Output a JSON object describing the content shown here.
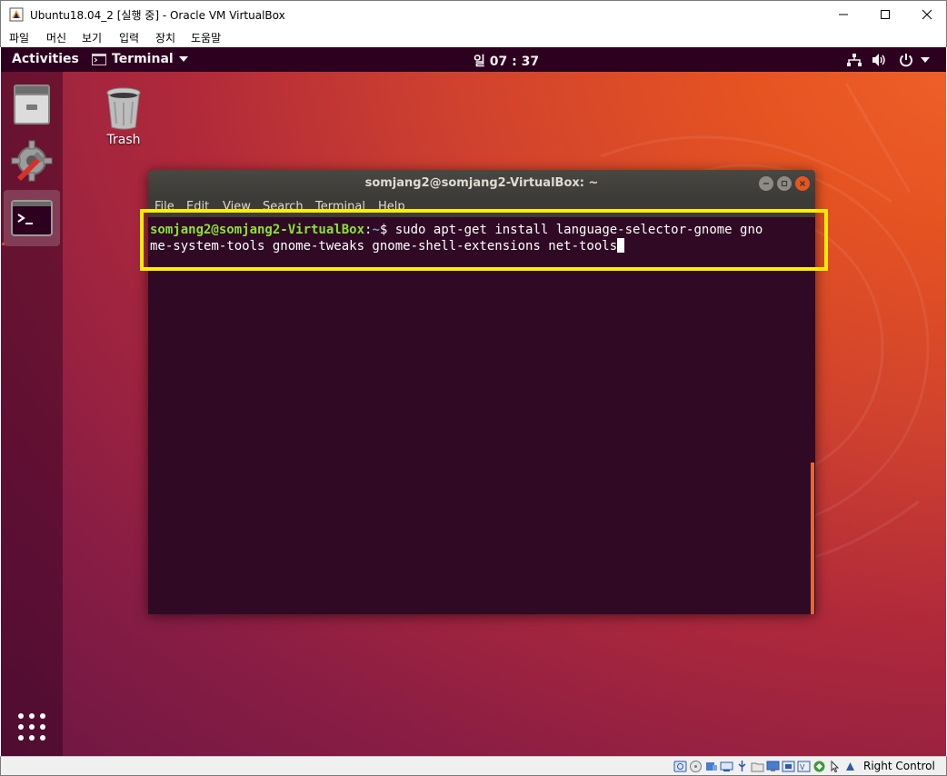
{
  "host_window": {
    "title": "Ubuntu18.04_2 [실행 중] - Oracle VM VirtualBox",
    "menu": [
      "파일",
      "머신",
      "보기",
      "입력",
      "장치",
      "도움말"
    ],
    "controls": {
      "minimize_icon": "minimize-icon",
      "maximize_icon": "maximize-icon",
      "close_icon": "close-icon"
    },
    "status": {
      "host_key": "Right Control"
    }
  },
  "gnome": {
    "activities_label": "Activities",
    "app_menu_label": "Terminal",
    "clock": "일 07 : 37",
    "tray_icons": [
      "network-icon",
      "volume-icon",
      "power-icon"
    ]
  },
  "dock": {
    "items": [
      {
        "name": "files",
        "icon": "file-cabinet-icon"
      },
      {
        "name": "settings",
        "icon": "gear-icon"
      },
      {
        "name": "terminal",
        "icon": "terminal-icon",
        "active": true
      }
    ],
    "show_apps_icon": "grid-icon"
  },
  "desktop": {
    "trash_label": "Trash"
  },
  "terminal": {
    "title": "somjang2@somjang2-VirtualBox: ~",
    "menu": [
      "File",
      "Edit",
      "View",
      "Search",
      "Terminal",
      "Help"
    ],
    "prompt_user": "somjang2@somjang2-VirtualBox",
    "prompt_colon": ":",
    "prompt_path": "~",
    "prompt_symbol": "$ ",
    "command_line1": "sudo apt-get install language-selector-gnome gno",
    "command_line2": "me-system-tools gnome-tweaks gnome-shell-extensions net-tools"
  },
  "colors": {
    "gnome_panel": "#2c001e",
    "terminal_bg": "#300a24",
    "prompt_user": "#8ae234",
    "prompt_path": "#729fcf",
    "accent": "#e95420",
    "highlight": "#ffee00"
  }
}
